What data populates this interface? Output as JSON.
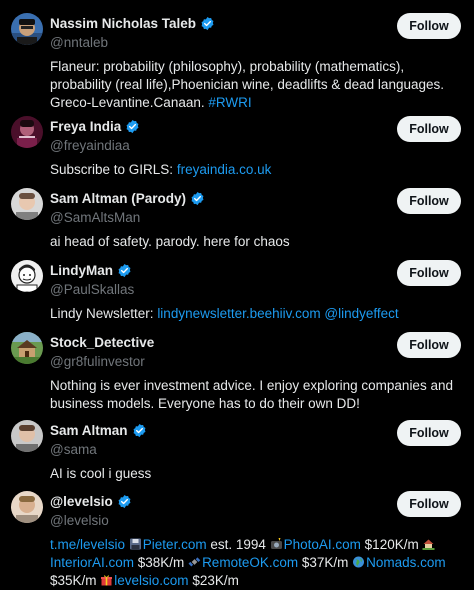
{
  "accounts": [
    {
      "name": "Nassim Nicholas Taleb",
      "handle": "@nntaleb",
      "verified": true,
      "follow_label": "Follow",
      "avatar": "taleb-avatar",
      "bio_text": "Flaneur: probability (philosophy), probability (mathematics), probability (real life),Phoenician wine, deadlifts & dead languages. Greco-Levantine.Canaan.",
      "bio_hashtag": "#RWRI"
    },
    {
      "name": "Freya India",
      "handle": "@freyaindiaa",
      "verified": true,
      "follow_label": "Follow",
      "avatar": "freya-avatar",
      "bio_text": "Subscribe to GIRLS:",
      "bio_link": "freyaindia.co.uk"
    },
    {
      "name": "Sam Altman (Parody)",
      "handle": "@SamAltsMan",
      "verified": true,
      "follow_label": "Follow",
      "avatar": "parody-avatar",
      "bio_text": "ai head of safety. parody. here for chaos"
    },
    {
      "name": "LindyMan",
      "handle": "@PaulSkallas",
      "verified": true,
      "follow_label": "Follow",
      "avatar": "lindyman-avatar",
      "bio_text": "Lindy Newsletter:",
      "bio_link": "lindynewsletter.beehiiv.com",
      "bio_mention": "@lindyeffect"
    },
    {
      "name": "Stock_Detective",
      "handle": "@gr8fulinvestor",
      "verified": false,
      "follow_label": "Follow",
      "avatar": "house-avatar",
      "bio_text": "Nothing is ever investment advice. I enjoy exploring companies and business models. Everyone has to do their own DD!"
    },
    {
      "name": "Sam Altman",
      "handle": "@sama",
      "verified": true,
      "follow_label": "Follow",
      "avatar": "sama-avatar",
      "bio_text": "AI is cool i guess"
    },
    {
      "name": "@levelsio",
      "handle": "@levelsio",
      "verified": true,
      "follow_label": "Follow",
      "avatar": "levelsio-avatar",
      "bio_parts": {
        "link1": "t.me/levelsio",
        "link2": "Pieter.com",
        "text2": " est. 1994 ",
        "link3": "PhotoAI.com",
        "text3": " $120K/m ",
        "link4": "InteriorAI.com",
        "text4": " $38K/m ",
        "link5": "RemoteOK.com",
        "text5": " $37K/m ",
        "link6": "Nomads.com",
        "text6": "$35K/m ",
        "link7": "levelsio.com",
        "text7": " $23K/m"
      }
    }
  ],
  "colors": {
    "background": "#000000",
    "text": "#e7e9ea",
    "secondary": "#71767b",
    "link": "#1d9bf0",
    "verified": "#1d9bf0",
    "button_bg": "#eff3f4"
  }
}
